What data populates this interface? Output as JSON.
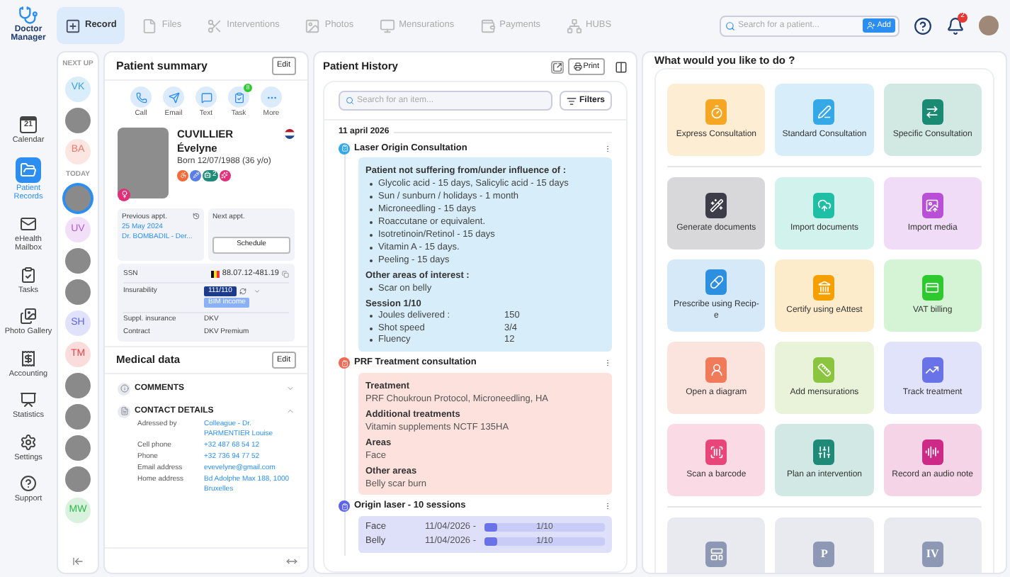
{
  "logo": {
    "line1": "Doctor",
    "line2": "Manager"
  },
  "nav": [
    {
      "label": "Calendar",
      "day": "21",
      "selected": false
    },
    {
      "label": "Patient Records",
      "selected": true
    },
    {
      "label": "eHealth Mailbox",
      "selected": false
    },
    {
      "label": "Tasks",
      "selected": false
    },
    {
      "label": "Photo Gallery",
      "selected": false
    },
    {
      "label": "Accounting",
      "selected": false
    },
    {
      "label": "Statistics",
      "selected": false
    },
    {
      "label": "Settings",
      "selected": false
    },
    {
      "label": "Support",
      "selected": false
    }
  ],
  "tabs": [
    {
      "label": "Record",
      "selected": true
    },
    {
      "label": "Files",
      "selected": false
    },
    {
      "label": "Interventions",
      "selected": false
    },
    {
      "label": "Photos",
      "selected": false
    },
    {
      "label": "Mensurations",
      "selected": false
    },
    {
      "label": "Payments",
      "selected": false
    },
    {
      "label": "HUBS",
      "selected": false
    }
  ],
  "patient_search": {
    "placeholder": "Search for a patient...",
    "button": "Add"
  },
  "notifications": {
    "count": "2"
  },
  "next_up": {
    "label": "NEXT UP",
    "today_label": "TODAY",
    "upcoming": [
      {
        "kind": "initials",
        "initials": "VK",
        "color": "#3aa0e6",
        "selected": false
      },
      {
        "kind": "photo",
        "selected": false
      },
      {
        "kind": "initials",
        "initials": "BA",
        "color": "#ee7a66",
        "selected": false
      }
    ],
    "today": [
      {
        "kind": "photo",
        "selected": true
      },
      {
        "kind": "initials",
        "initials": "UV",
        "color": "#b35ad6",
        "selected": false
      },
      {
        "kind": "photo",
        "selected": false
      },
      {
        "kind": "photo",
        "selected": false
      },
      {
        "kind": "initials",
        "initials": "SH",
        "color": "#5b63e8",
        "selected": false
      },
      {
        "kind": "initials",
        "initials": "TM",
        "color": "#e84545",
        "selected": false
      },
      {
        "kind": "photo",
        "selected": false
      },
      {
        "kind": "photo",
        "selected": false
      },
      {
        "kind": "photo",
        "selected": false
      },
      {
        "kind": "photo",
        "selected": false
      },
      {
        "kind": "initials",
        "initials": "MW",
        "color": "#2fb84a",
        "selected": false
      }
    ]
  },
  "summary": {
    "title": "Patient summary",
    "edit": "Edit",
    "actions": [
      {
        "label": "Call"
      },
      {
        "label": "Email"
      },
      {
        "label": "Text"
      },
      {
        "label": "Task",
        "badge": "8"
      },
      {
        "label": "More"
      }
    ],
    "last_name": "CUVILLIER",
    "first_name": "Évelyne",
    "born": "Born 12/07/1988 (36 y/o)",
    "tags": [
      {
        "color": "#f26b3a"
      },
      {
        "color": "#5b7ee5"
      },
      {
        "color": "#1e8a77",
        "count": "2"
      },
      {
        "color": "#e0307a"
      }
    ],
    "previous": {
      "label": "Previous appt.",
      "date": "25 May 2024",
      "doctor": "Dr. BOMBADIL - Der..."
    },
    "next": {
      "label": "Next appt.",
      "button": "Schedule"
    },
    "ssn": {
      "label": "SSN",
      "value": "88.07.12-481.19"
    },
    "insurability": {
      "label": "Insurability",
      "code": "111/110",
      "status": "BIM income"
    },
    "insurance": [
      {
        "label": "Suppl. insurance",
        "value": "DKV"
      },
      {
        "label": "Contract",
        "value": "DKV Premium"
      }
    ]
  },
  "medical": {
    "title": "Medical data",
    "edit": "Edit",
    "sections": [
      {
        "title": "COMMENTS",
        "expanded": false
      },
      {
        "title": "CONTACT DETAILS",
        "expanded": true,
        "rows": [
          {
            "label": "Adressed by",
            "value": "Colleague - Dr. PARMENTIER Louise"
          },
          {
            "label": "Cell phone",
            "value": "+32 487 68 54 12"
          },
          {
            "label": "Phone",
            "value": "+32 736 94 77 52"
          },
          {
            "label": "Email address",
            "value": "evevelyne@gmail.com"
          },
          {
            "label": "Home address",
            "value": "Bd Adolphe Max 188, 1000 Bruxelles"
          }
        ]
      }
    ]
  },
  "history": {
    "title": "Patient History",
    "print": "Print",
    "search_placeholder": "Search for an item...",
    "filters": "Filters",
    "date": "11 april 2026",
    "entries": [
      {
        "title": "Laser Origin Consultation",
        "color": "#35a8e8",
        "blocks": [
          {
            "kind": "heading",
            "text": "Patient not suffering from/under influence of :"
          },
          {
            "kind": "bullet",
            "text": "Glycolic acid - 15 days, Salicylic acid - 15 days"
          },
          {
            "kind": "bullet",
            "text": "Sun / sunburn / holidays - 1 month"
          },
          {
            "kind": "bullet",
            "text": "Microneedling - 15 days"
          },
          {
            "kind": "bullet",
            "text": "Roaccutane or equivalent."
          },
          {
            "kind": "bullet",
            "text": "Isotretinoin/Retinol - 15 days"
          },
          {
            "kind": "bullet",
            "text": "Vitamin A - 15 days."
          },
          {
            "kind": "bullet",
            "text": "Peeling - 15 days"
          },
          {
            "kind": "heading",
            "text": "Other areas of interest :"
          },
          {
            "kind": "bullet",
            "text": "Scar on belly"
          },
          {
            "kind": "heading",
            "text": "Session 1/10"
          },
          {
            "kind": "bullet_value",
            "text": "Joules delivered :",
            "value": "150"
          },
          {
            "kind": "bullet_value",
            "text": "Shot speed",
            "value": "3/4"
          },
          {
            "kind": "bullet_value",
            "text": "Fluency",
            "value": "12"
          }
        ]
      },
      {
        "title": "PRF Treatment consultation",
        "color": "#ee6a55",
        "blocks": [
          {
            "kind": "heading",
            "text": "Treatment"
          },
          {
            "kind": "value",
            "text": "PRF Choukroun Protocol, Microneedling, HA"
          },
          {
            "kind": "heading",
            "text": "Additional treatments"
          },
          {
            "kind": "value",
            "text": "Vitamin supplements NCTF 135HA"
          },
          {
            "kind": "heading",
            "text": "Areas"
          },
          {
            "kind": "value",
            "text": "Face"
          },
          {
            "kind": "heading",
            "text": "Other areas"
          },
          {
            "kind": "value",
            "text": "Belly scar burn"
          }
        ]
      },
      {
        "title": "Origin laser - 10 sessions",
        "color": "#5b63e8",
        "blocks": [
          {
            "kind": "progress",
            "text": "Face",
            "date": "11/04/2026 -",
            "level": 0.1,
            "reading": "1/10"
          },
          {
            "kind": "progress",
            "text": "Belly",
            "date": "11/04/2026 -",
            "level": 0.1,
            "reading": "1/10"
          }
        ]
      }
    ]
  },
  "actions": {
    "title": "What would you like to do ?",
    "groups": [
      {
        "tiles": [
          {
            "label": "Express Consultation",
            "color": "#f5a623"
          },
          {
            "label": "Standard Consultation",
            "color": "#35a8e8"
          },
          {
            "label": "Specific Consultation",
            "color": "#1a8a73"
          }
        ]
      },
      {
        "tiles": [
          {
            "label": "Generate documents",
            "color": "#3d3d4a"
          },
          {
            "label": "Import documents",
            "color": "#1fbfa6"
          },
          {
            "label": "Import media",
            "color": "#b94fd6"
          },
          {
            "label": "Prescribe using Recip-e",
            "color": "#2d8fe0"
          },
          {
            "label": "Certify using eAttest",
            "color": "#f5a000"
          },
          {
            "label": "VAT billing",
            "color": "#2ec92e"
          },
          {
            "label": "Open a diagram",
            "color": "#f07a5a"
          },
          {
            "label": "Add mensurations",
            "color": "#8bc53f"
          },
          {
            "label": "Track treatment",
            "color": "#6a72e8"
          },
          {
            "label": "Scan a barcode",
            "color": "#e8457a"
          },
          {
            "label": "Plan an intervention",
            "color": "#1e8a77"
          },
          {
            "label": "Record an audio note",
            "color": "#cc2a86"
          }
        ]
      },
      {
        "tiles": [
          {
            "color": "#8c98b4"
          },
          {
            "glyph": "P",
            "color": "#8c98b4"
          },
          {
            "glyph": "IV",
            "color": "#8c98b4"
          }
        ]
      }
    ]
  }
}
